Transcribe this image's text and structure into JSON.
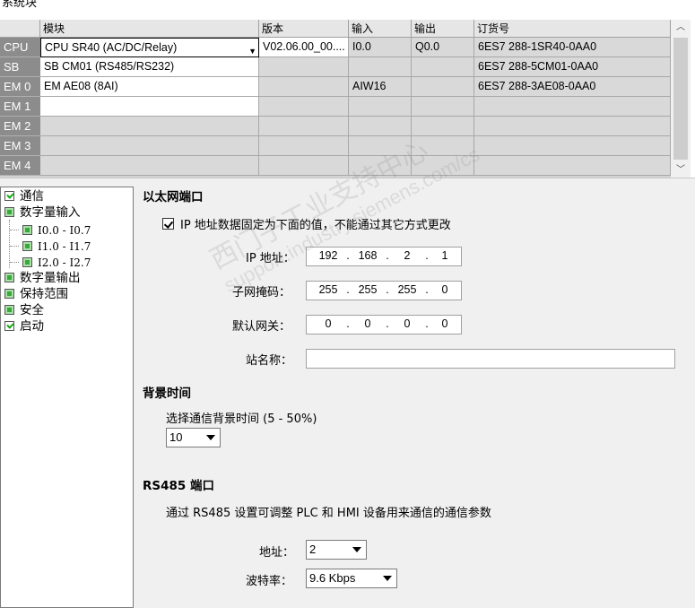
{
  "window": {
    "title": "系统块"
  },
  "grid": {
    "headers": [
      "模块",
      "版本",
      "输入",
      "输出",
      "订货号"
    ],
    "rows": [
      {
        "label": "CPU",
        "module": "CPU SR40 (AC/DC/Relay)",
        "version": "V02.06.00_00....",
        "input": "I0.0",
        "output": "Q0.0",
        "order": "6ES7 288-1SR40-0AA0"
      },
      {
        "label": "SB",
        "module": "SB CM01 (RS485/RS232)",
        "version": "",
        "input": "",
        "output": "",
        "order": "6ES7 288-5CM01-0AA0"
      },
      {
        "label": "EM 0",
        "module": "EM AE08 (8AI)",
        "version": "",
        "input": "AIW16",
        "output": "",
        "order": "6ES7 288-3AE08-0AA0"
      },
      {
        "label": "EM 1",
        "module": "",
        "version": "",
        "input": "",
        "output": "",
        "order": ""
      },
      {
        "label": "EM 2",
        "module": "",
        "version": "",
        "input": "",
        "output": "",
        "order": ""
      },
      {
        "label": "EM 3",
        "module": "",
        "version": "",
        "input": "",
        "output": "",
        "order": ""
      },
      {
        "label": "EM 4",
        "module": "",
        "version": "",
        "input": "",
        "output": "",
        "order": ""
      }
    ]
  },
  "tree": {
    "items": [
      {
        "label": "通信",
        "icon": "checked-icon"
      },
      {
        "label": "数字量输入",
        "icon": "green-square-icon"
      },
      {
        "label": "I0.0 - I0.7",
        "icon": "green-square-icon"
      },
      {
        "label": "I1.0 - I1.7",
        "icon": "green-square-icon"
      },
      {
        "label": "I2.0 - I2.7",
        "icon": "green-square-icon"
      },
      {
        "label": "数字量输出",
        "icon": "green-square-icon"
      },
      {
        "label": "保持范围",
        "icon": "green-square-icon"
      },
      {
        "label": "安全",
        "icon": "green-square-icon"
      },
      {
        "label": "启动",
        "icon": "checked-icon"
      }
    ]
  },
  "ethernet": {
    "title": "以太网端口",
    "fixed_ip_label": "IP 地址数据固定为下面的值，不能通过其它方式更改",
    "fixed_ip_checked": true,
    "ip_label": "IP 地址：",
    "ip": [
      "192",
      "168",
      "2",
      "1"
    ],
    "mask_label": "子网掩码：",
    "mask": [
      "255",
      "255",
      "255",
      "0"
    ],
    "gateway_label": "默认网关：",
    "gateway": [
      "0",
      "0",
      "0",
      "0"
    ],
    "station_label": "站名称：",
    "station": ""
  },
  "background": {
    "title": "背景时间",
    "select_label": "选择通信背景时间 (5 - 50%)",
    "value": "10"
  },
  "rs485": {
    "title": "RS485  端口",
    "desc": "通过 RS485 设置可调整 PLC 和 HMI 设备用来通信的通信参数",
    "address_label": "地址：",
    "address": "2",
    "baud_label": "波特率：",
    "baud": "9.6 Kbps"
  },
  "watermark": {
    "line1": "西门子工业支持中心",
    "line2": "support.industry.siemens.com/cs"
  }
}
